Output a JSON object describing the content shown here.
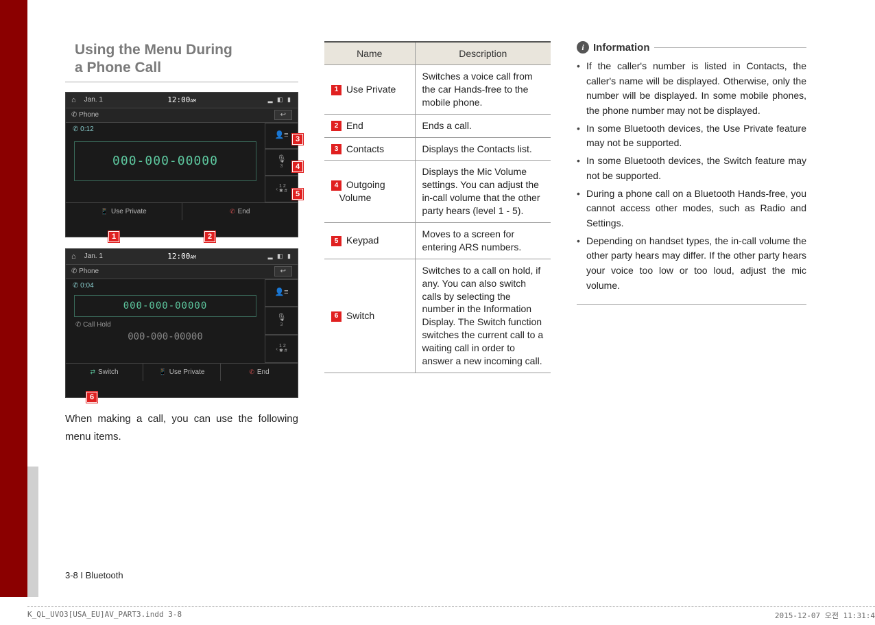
{
  "section_title_l1": "Using the Menu During",
  "section_title_l2": "a Phone Call",
  "screenshot_a": {
    "date": "Jan. 1",
    "clock": "12:00",
    "clock_ampm": "AM",
    "phone_label": "Phone",
    "back_glyph": "↩",
    "timer": "0:12",
    "number": "000-000-00000",
    "side": {
      "contacts_sub": "",
      "vol_sub": "3",
      "keypad_sub": ""
    },
    "bottom": {
      "use_private": "Use Private",
      "end": "End"
    },
    "tags": {
      "t1": "1",
      "t2": "2",
      "t3": "3",
      "t4": "4",
      "t5": "5"
    }
  },
  "screenshot_b": {
    "date": "Jan. 1",
    "clock": "12:00",
    "clock_ampm": "AM",
    "phone_label": "Phone",
    "back_glyph": "↩",
    "timer": "0:04",
    "number": "000-000-00000",
    "hold_label": "Call Hold",
    "number2": "000-000-00000",
    "bottom": {
      "switch": "Switch",
      "use_private": "Use Private",
      "end": "End"
    },
    "tag6": "6"
  },
  "caption": "When making a call, you can use the following menu items.",
  "table": {
    "head_name": "Name",
    "head_desc": "Description",
    "rows": [
      {
        "n": "1",
        "name": "Use Private",
        "desc": "Switches a voice call from the car Hands-free to the mobile phone."
      },
      {
        "n": "2",
        "name": "End",
        "desc": "Ends a call."
      },
      {
        "n": "3",
        "name": "Contacts",
        "desc": "Displays the Contacts list."
      },
      {
        "n": "4",
        "name": "Outgoing\n   Volume",
        "desc": "Displays the Mic Volume settings. You can adjust the in-call volume that the other party hears (level 1 - 5)."
      },
      {
        "n": "5",
        "name": "Keypad",
        "desc": "Moves to a screen for entering ARS numbers."
      },
      {
        "n": "6",
        "name": "Switch",
        "desc": "Switches to a call on hold, if any. You can also switch calls by selecting the number in the Information Display. The Switch function switches the current call to a waiting call in order to answer a new incoming call."
      }
    ]
  },
  "info": {
    "title": "Information",
    "items": [
      "If the caller's number is listed in Contacts, the caller's name will be displayed. Otherwise, only the number will be displayed. In some mobile phones, the phone number may not be displayed.",
      "In some Bluetooth devices, the Use Private feature may not be supported.",
      "In some Bluetooth devices, the Switch feature may not be supported.",
      "During a phone call on a Bluetooth Hands-free, you cannot access other modes, such as Radio and Settings.",
      "Depending on handset types, the in-call volume the other party hears may differ. If the other party hears your voice too low or too loud, adjust the mic volume."
    ]
  },
  "footer": "3-8 I Bluetooth",
  "print": {
    "file": "K_QL_UVO3[USA_EU]AV_PART3.indd   3-8",
    "timestamp": "2015-12-07   오전 11:31:4"
  }
}
